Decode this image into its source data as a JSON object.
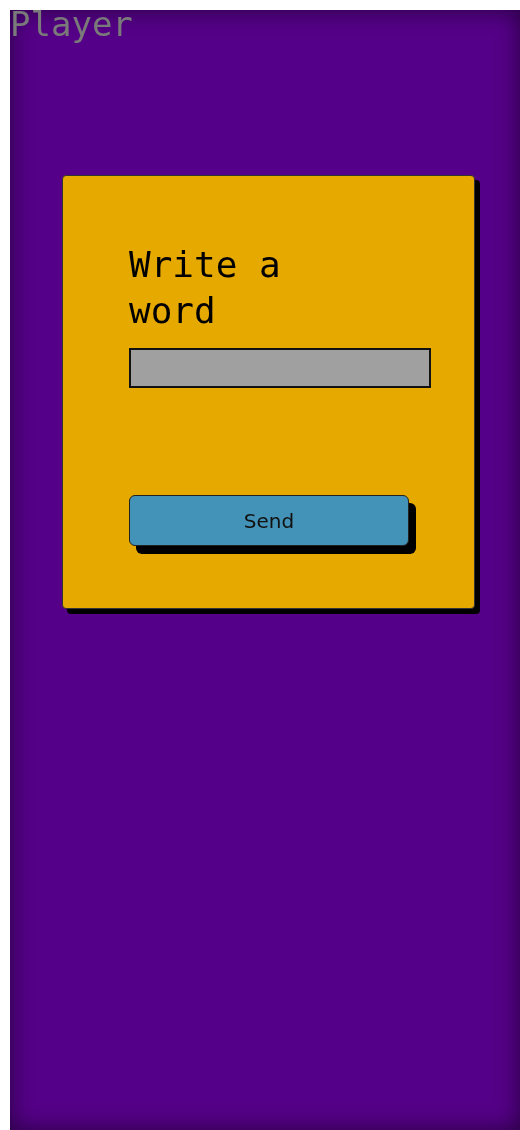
{
  "title": "Player",
  "card": {
    "heading": "Write a word",
    "fields": [
      {
        "kind": "text"
      }
    ],
    "button": "Send"
  }
}
